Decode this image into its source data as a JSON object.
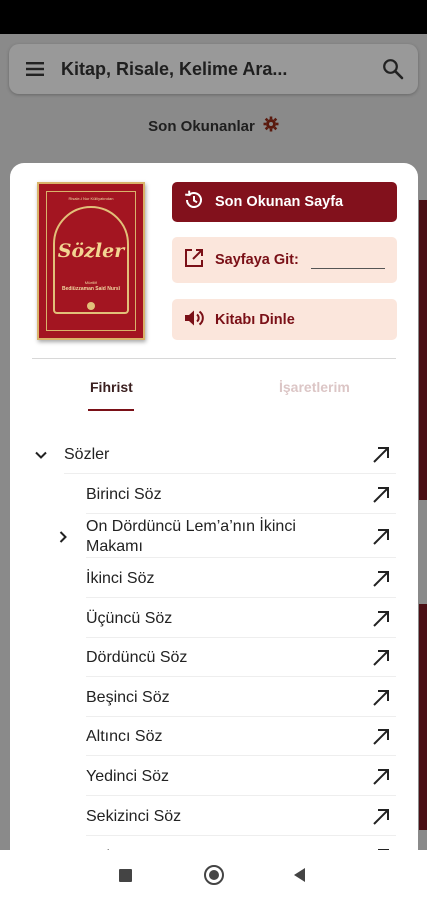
{
  "search": {
    "placeholder": "Kitap, Risale, Kelime Ara..."
  },
  "recent": {
    "title": "Son Okunanlar"
  },
  "book": {
    "top_text": "Risale-i Nur Külliyatından",
    "title": "Sözler",
    "author_label": "Müellifi",
    "author_name": "Bediüzzaman Said Nursî"
  },
  "actions": {
    "recent_page": "Son Okunan Sayfa",
    "goto_page": "Sayfaya Git:",
    "listen": "Kitabı Dinle"
  },
  "tabs": {
    "index": "Fihrist",
    "bookmarks": "İşaretlerim"
  },
  "toc": [
    {
      "label": "Sözler",
      "level": 0,
      "chevron": "down"
    },
    {
      "label": "Birinci Söz",
      "level": 1,
      "chevron": ""
    },
    {
      "label": "On Dördüncü Lem’a’nın İkinci Makamı",
      "level": 1,
      "chevron": "right"
    },
    {
      "label": "İkinci Söz",
      "level": 1,
      "chevron": ""
    },
    {
      "label": "Üçüncü Söz",
      "level": 1,
      "chevron": ""
    },
    {
      "label": "Dördüncü Söz",
      "level": 1,
      "chevron": ""
    },
    {
      "label": "Beşinci Söz",
      "level": 1,
      "chevron": ""
    },
    {
      "label": "Altıncı Söz",
      "level": 1,
      "chevron": ""
    },
    {
      "label": "Yedinci Söz",
      "level": 1,
      "chevron": ""
    },
    {
      "label": "Sekizinci Söz",
      "level": 1,
      "chevron": ""
    },
    {
      "label": "Dokuzuncu Söz",
      "level": 1,
      "chevron": "right"
    }
  ],
  "colors": {
    "primary": "#82111c",
    "tint": "#fbe6dc",
    "cover": "#a31521",
    "gold": "#d9b36a"
  }
}
